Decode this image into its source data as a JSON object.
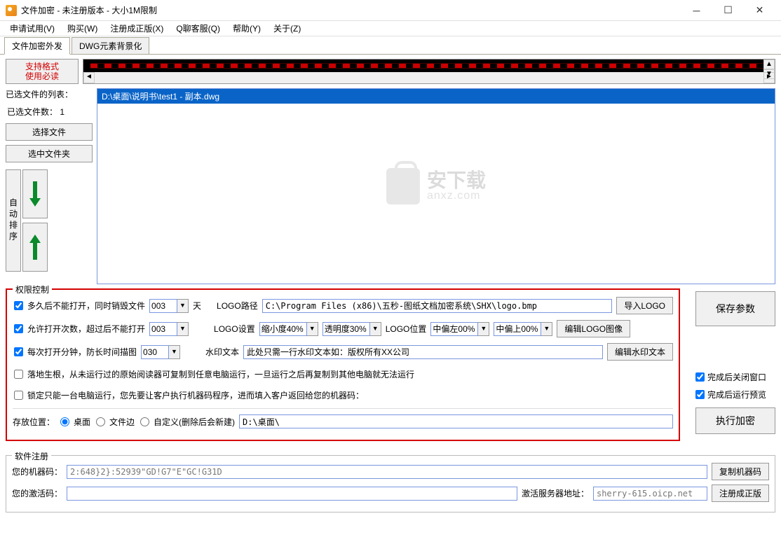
{
  "titlebar": {
    "title": "文件加密 - 未注册版本 - 大小1M限制"
  },
  "menu": [
    "申请试用(V)",
    "购买(W)",
    "注册成正版(X)",
    "Q聊客服(Q)",
    "帮助(Y)",
    "关于(Z)"
  ],
  "tabs": {
    "t1": "文件加密外发",
    "t2": "DWG元素背景化"
  },
  "left": {
    "fmt1": "支持格式",
    "fmt2": "使用必读",
    "list_label": "已选文件的列表：",
    "count_label": "已选文件数：",
    "count_value": "1",
    "select_file": "选择文件",
    "select_folder": "选中文件夹",
    "auto_sort": "自动排序"
  },
  "filelist": {
    "item0": "D:\\桌面\\说明书\\test1 - 副本.dwg"
  },
  "watermark": {
    "cn": "安下载",
    "en": "anxz.com"
  },
  "perm": {
    "legend": "权限控制",
    "r1": {
      "label": "多久后不能打开，同时销毁文件",
      "days": "003",
      "days_unit": "天",
      "logo_path_label": "LOGO路径",
      "logo_path": "C:\\Program Files (x86)\\五秒-图纸文档加密系统\\SHX\\logo.bmp",
      "import_logo": "导入LOGO"
    },
    "r2": {
      "label": "允许打开次数，超过后不能打开",
      "times": "003",
      "logo_set_label": "LOGO设置",
      "scale": "缩小度40%",
      "trans": "透明度30%",
      "pos_label": "LOGO位置",
      "posx": "中偏左00%",
      "posy": "中偏上00%",
      "edit_logo": "编辑LOGO图像"
    },
    "r3": {
      "label": "每次打开分钟，防长时间描图",
      "mins": "030",
      "wm_label": "水印文本",
      "wm_text": "此处只需一行水印文本如：版权所有XX公司",
      "edit_wm": "编辑水印文本"
    },
    "r4": "落地生根，从未运行过的原始阅读器可复制到任意电脑运行，一旦运行之后再复制到其他电脑就无法运行",
    "r5": "锁定只能一台电脑运行，您先要让客户执行机器码程序，进而填入客户返回给您的机器码：",
    "save_loc_label": "存放位置：",
    "loc_desktop": "桌面",
    "loc_fileside": "文件边",
    "loc_custom": "自定义(删除后会新建)",
    "loc_path": "D:\\桌面\\"
  },
  "right": {
    "save_params": "保存参数",
    "close_after": "完成后关闭窗口",
    "preview_after": "完成后运行预览",
    "execute": "执行加密"
  },
  "reg": {
    "legend": "软件注册",
    "machine_label": "您的机器码：",
    "machine_code": "2:648}2}:52939\"GD!G7\"E\"GC!G31D",
    "copy_machine": "复制机器码",
    "activate_label": "您的激活码：",
    "server_label": "激活服务器地址：",
    "server": "sherry-615.oicp.net",
    "reg_btn": "注册成正版"
  }
}
